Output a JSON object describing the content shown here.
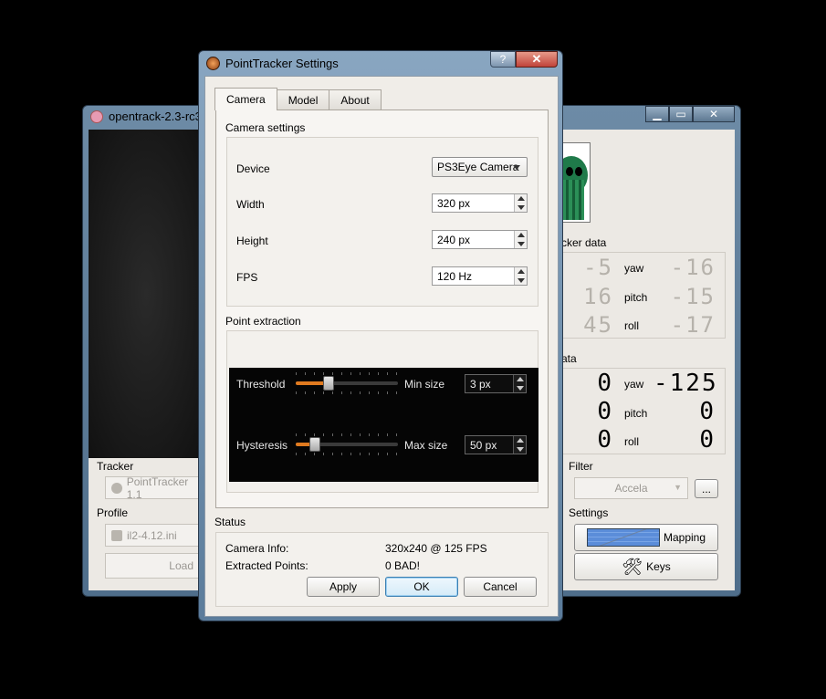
{
  "main_window": {
    "title": "opentrack-2.3-rc3-",
    "tracker_group": "Tracker",
    "tracker_value": "PointTracker 1.1",
    "profile_group": "Profile",
    "profile_value": "il2-4.12.ini",
    "load_button": "Load",
    "tracker_data_title": "cker data",
    "raw_data": [
      {
        "left": "-5",
        "axis": "yaw",
        "right": "-16"
      },
      {
        "left": "16",
        "axis": "pitch",
        "right": "-15"
      },
      {
        "left": "45",
        "axis": "roll",
        "right": "-17"
      }
    ],
    "game_data_title": "ata",
    "game_data": [
      {
        "left": "0",
        "axis": "yaw",
        "right": "-125"
      },
      {
        "left": "0",
        "axis": "pitch",
        "right": "0"
      },
      {
        "left": "0",
        "axis": "roll",
        "right": "0"
      }
    ],
    "filter_group": "Filter",
    "filter_value": "Accela",
    "filter_more_button": "...",
    "settings_group": "Settings",
    "mapping_button": "Mapping",
    "keys_button": "Keys",
    "window_controls": {
      "minimize": "▁",
      "maximize": "▭",
      "close": "✕"
    }
  },
  "dialog": {
    "title": "PointTracker Settings",
    "help_button": "?",
    "close_button": "✕",
    "tabs": [
      {
        "label": "Camera",
        "active": true
      },
      {
        "label": "Model",
        "active": false
      },
      {
        "label": "About",
        "active": false
      }
    ],
    "camera_settings": {
      "title": "Camera settings",
      "device_label": "Device",
      "device_value": "PS3Eye Camera",
      "width_label": "Width",
      "width_value": "320 px",
      "height_label": "Height",
      "height_value": "240 px",
      "fps_label": "FPS",
      "fps_value": "120 Hz"
    },
    "point_extraction": {
      "title": "Point extraction",
      "threshold_label": "Threshold",
      "threshold_level": 0.3,
      "min_size_label": "Min size",
      "min_size_value": "3 px",
      "hysteresis_label": "Hysteresis",
      "hysteresis_level": 0.15,
      "max_size_label": "Max size",
      "max_size_value": "50 px"
    },
    "status": {
      "title": "Status",
      "camera_info_label": "Camera Info:",
      "camera_info_value": "320x240 @ 125 FPS",
      "extracted_points_label": "Extracted Points:",
      "extracted_points_value": "0 BAD!"
    },
    "buttons": {
      "apply": "Apply",
      "ok": "OK",
      "cancel": "Cancel"
    },
    "accent_color": "#e07a1f"
  }
}
